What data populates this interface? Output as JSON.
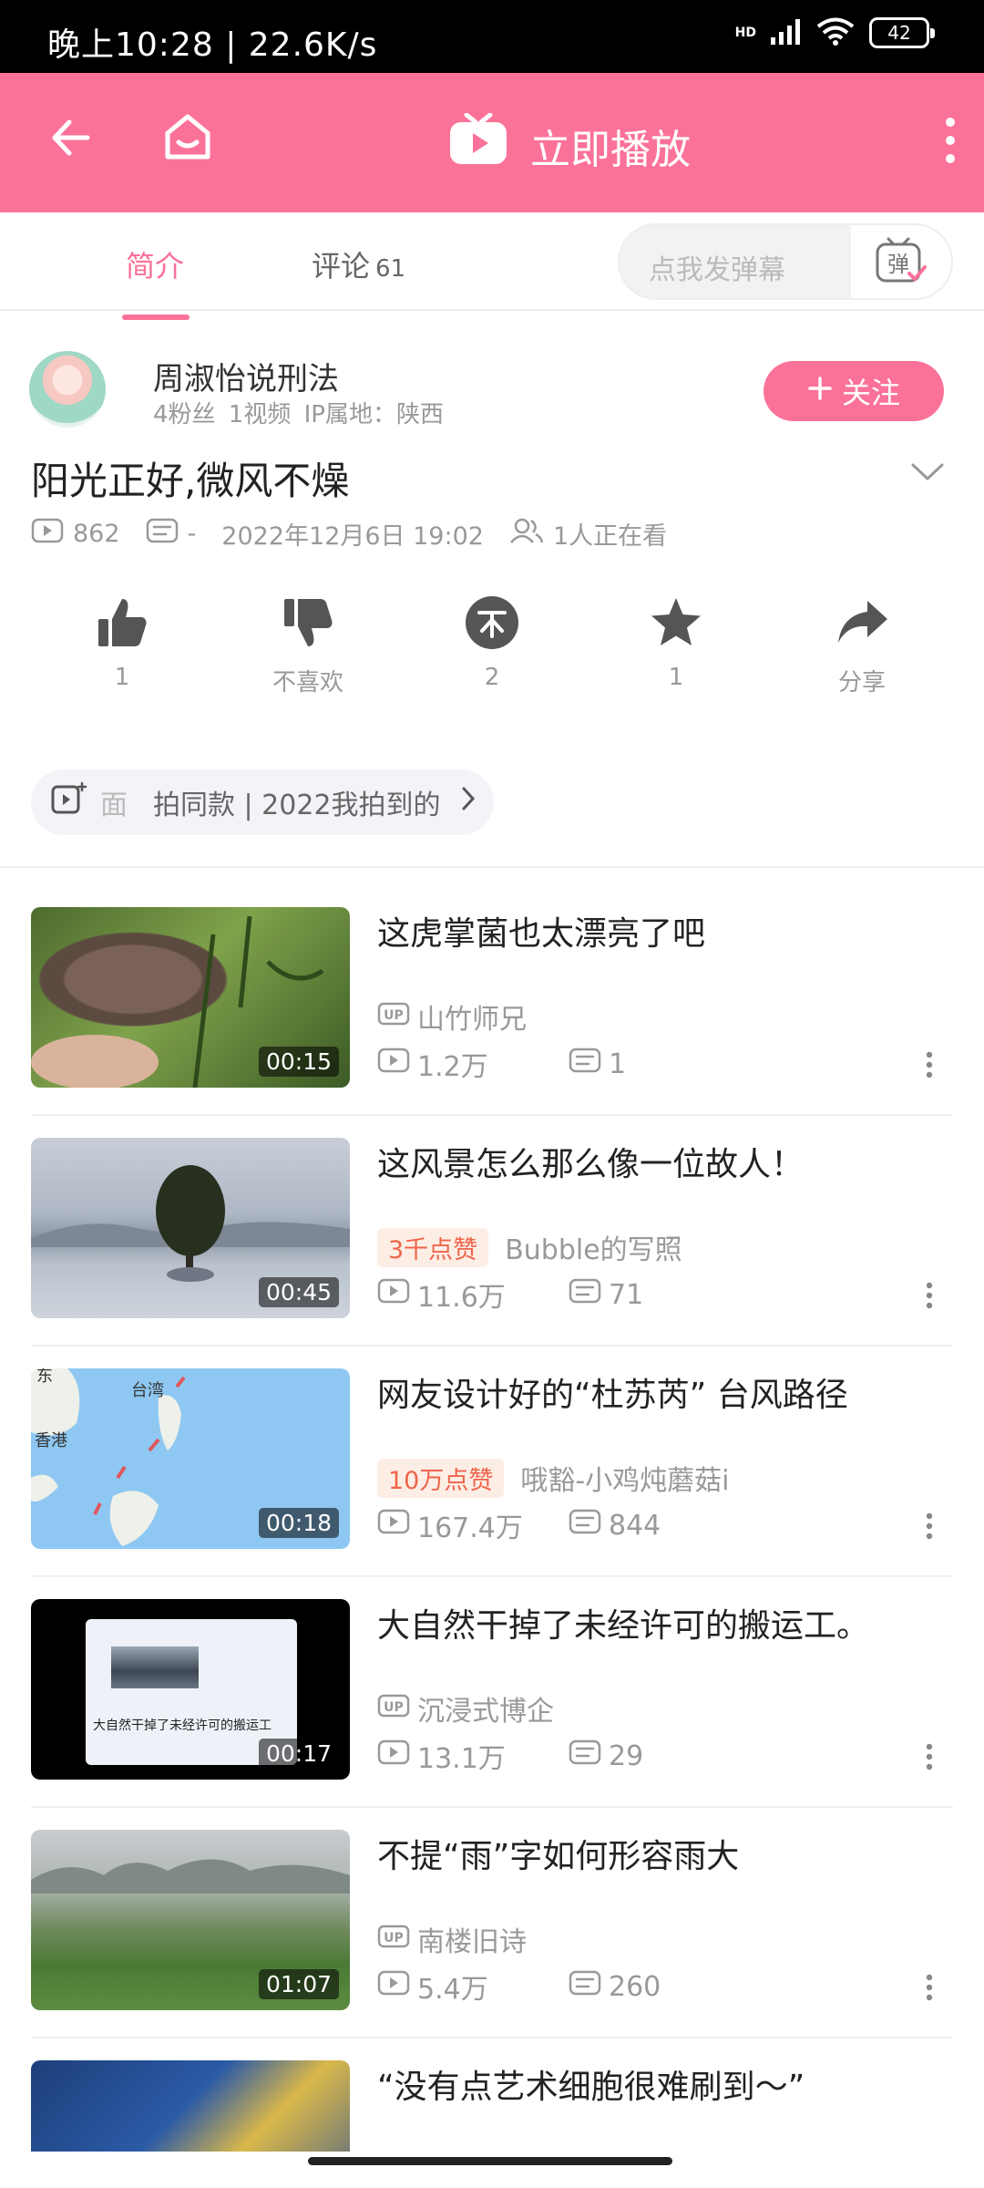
{
  "status_bar": {
    "time": "晚上10:28 | 22.6K/s",
    "network": "HD",
    "battery": "42"
  },
  "app_bar": {
    "play_label": "立即播放",
    "accent_color": "#fb7299"
  },
  "tabs": [
    {
      "label": "简介",
      "active": true
    },
    {
      "label": "评论",
      "count": "61"
    }
  ],
  "danmaku": {
    "placeholder": "点我发弹幕",
    "button": "弹"
  },
  "uploader": {
    "name": "周淑怡说刑法",
    "meta": "4粉丝 1视频 IP属地：陕西",
    "follow_label": "关注"
  },
  "video": {
    "title": "阳光正好,微风不燥",
    "views": "862",
    "danmaku_count": "-",
    "date": "2022年12月6日 19:02",
    "watching": "1人正在看"
  },
  "actions": [
    {
      "icon": "thumbs-up-icon",
      "label": "1"
    },
    {
      "icon": "thumbs-down-icon",
      "label": "不喜欢"
    },
    {
      "icon": "coin-icon",
      "label": "2"
    },
    {
      "icon": "star-icon",
      "label": "1"
    },
    {
      "icon": "share-icon",
      "label": "分享"
    }
  ],
  "promo": {
    "prefix": "面",
    "text": "拍同款 | 2022我拍到的"
  },
  "related": [
    {
      "title": "这虎掌菌也太漂亮了吧",
      "duration": "00:15",
      "badge": "",
      "author": "山竹师兄",
      "author_up": true,
      "views": "1.2万",
      "comments": "1"
    },
    {
      "title": "这风景怎么那么像一位故人！",
      "duration": "00:45",
      "badge": "3千点赞",
      "author": "Bubble的写照",
      "author_up": false,
      "views": "11.6万",
      "comments": "71"
    },
    {
      "title": "网友设计好的“杜苏芮” 台风路径",
      "duration": "00:18",
      "badge": "10万点赞",
      "author": "哦豁-小鸡炖蘑菇i",
      "author_up": false,
      "views": "167.4万",
      "comments": "844",
      "map_labels": [
        "东",
        "台湾",
        "香港"
      ]
    },
    {
      "title": "大自然干掉了未经许可的搬运工。",
      "duration": "00:17",
      "badge": "",
      "author": "沉浸式博企",
      "author_up": true,
      "views": "13.1万",
      "comments": "29",
      "thumb_caption": "大自然干掉了未经许可的搬运工"
    },
    {
      "title": "不提“雨”字如何形容雨大",
      "duration": "01:07",
      "badge": "",
      "author": "南楼旧诗",
      "author_up": true,
      "views": "5.4万",
      "comments": "260"
    },
    {
      "title": "“没有点艺术细胞很难刷到～”",
      "duration": "",
      "badge": "",
      "author": "",
      "author_up": false,
      "views": "",
      "comments": ""
    }
  ]
}
